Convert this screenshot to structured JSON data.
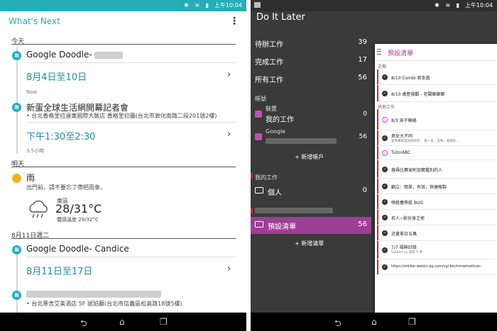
{
  "status": {
    "time": "上午10:04",
    "icons": "✱ ≋ ▮"
  },
  "whats_next": {
    "title": "What's Next",
    "sections": {
      "today": "今天",
      "tomorrow": "明天",
      "aug11": "8月11日週二"
    },
    "events": [
      {
        "title": "Google Doodle-",
        "date": "8月4日至10日",
        "small": "Now"
      },
      {
        "title": "新蛋全球生活網開幕記者會",
        "sub": "• 台北香格里拉遠東國際大飯店 香格里拉廳(台北市敦化南路二段201號2樓)",
        "date": "下午1:30至2:30",
        "small": "3.5小時"
      },
      {
        "title": "Google Doodle- Candice",
        "date": "8月11日至17日"
      },
      {
        "sub": "• 台北寒舍艾美酒店 5F 琥珀廳(台北市信義區松高路18號5樓)"
      }
    ],
    "weather": {
      "title": "雨",
      "sub": "出門前，請不要忘了帶把雨傘。",
      "district": "東區",
      "temp": "28/31°C",
      "feels": "體感溫度 29/32°C"
    }
  },
  "do_it_later": {
    "title": "Do It Later",
    "lists": [
      {
        "label": "待辦工作",
        "count": "39"
      },
      {
        "label": "完成工作",
        "count": "17"
      },
      {
        "label": "所有工作",
        "count": "56"
      }
    ],
    "accounts_section": "帳號",
    "accounts": [
      {
        "label": "裝置",
        "name": "我的工作",
        "count": "0"
      },
      {
        "label": "Google",
        "name": "",
        "count": "56"
      }
    ],
    "add_account": "新增帳戶",
    "my_work_section": "我的工作",
    "folders": [
      {
        "label": "個人",
        "count": "0"
      },
      {
        "label": "預設清單",
        "count": "56"
      }
    ],
    "add_list": "新增清單",
    "panel": {
      "title": "預設清單",
      "recent_section": "近期",
      "other_section": "其他工作",
      "recent": [
        {
          "label": "8/10 Combi 商条盖"
        },
        {
          "label": "8/10 桌歷視觀 - 老闆聊聊聊"
        }
      ],
      "other": [
        {
          "label": "8/3 吳子聯絡",
          "pink": true
        },
        {
          "label": "男女大不同",
          "sub": "愛情專家說的很經常... 第一名，沒事，真感好..."
        },
        {
          "label": "TutorABC",
          "pink": true
        },
        {
          "label": "搜尋比賽並附加實鑑別的人"
        },
        {
          "label": "翻立：簡單，有效，快捷報製"
        },
        {
          "label": "噴殺養熟殺 BUG"
        },
        {
          "label": "名人~影份身乏術"
        },
        {
          "label": "流量單日五萬"
        },
        {
          "label": "7/7 福無討錢",
          "sub": "Gabber Lu 拿影 5 頁"
        },
        {
          "label": "https://sticker.weixin.qq.com/cgi-bin/mmemoticon-"
        }
      ]
    }
  },
  "nav": {
    "back": "⮌",
    "home": "⌂",
    "recents": "❐"
  }
}
